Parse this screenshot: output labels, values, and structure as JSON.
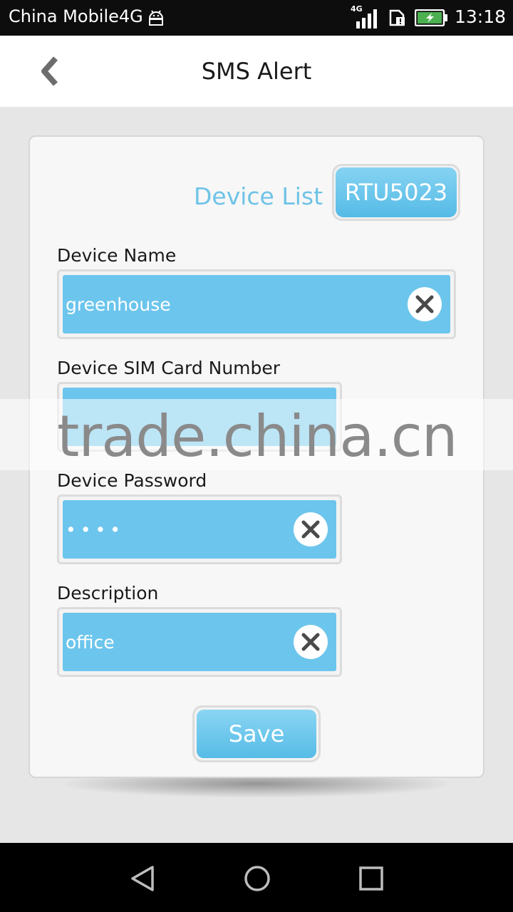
{
  "status_bar": {
    "carrier": "China Mobile4G",
    "network": "4G",
    "time": "13:18"
  },
  "header": {
    "title": "SMS Alert",
    "back_icon": "chevron-left-icon"
  },
  "device_list": {
    "label": "Device List",
    "selected": "RTU5023"
  },
  "fields": {
    "device_name": {
      "label": "Device Name",
      "value": "greenhouse"
    },
    "sim_number": {
      "label": "Device SIM Card Number",
      "value": ""
    },
    "password": {
      "label": "Device Password",
      "value": "••••"
    },
    "description": {
      "label": "Description",
      "value": "office"
    }
  },
  "watermark": "trade.china.cn",
  "save_label": "Save",
  "nav": {
    "back_icon": "triangle-back-icon",
    "home_icon": "circle-home-icon",
    "recents_icon": "square-recents-icon"
  },
  "colors": {
    "accent": "#6cc5ec",
    "label_accent": "#6ec3e6",
    "card_bg": "#f7f7f7",
    "page_bg": "#e6e6e6"
  }
}
